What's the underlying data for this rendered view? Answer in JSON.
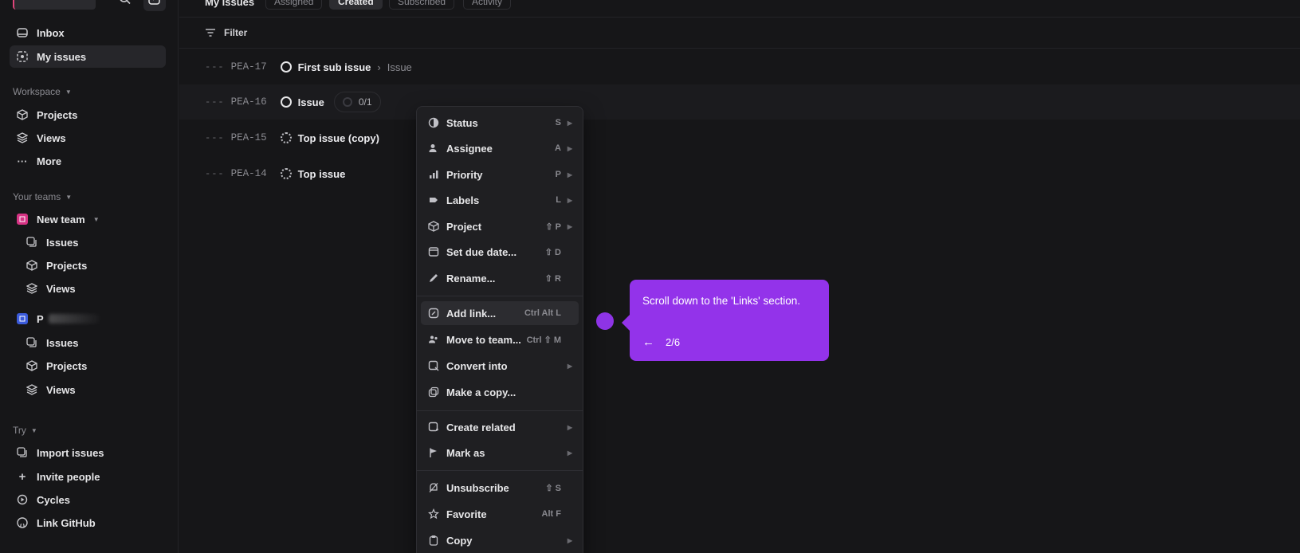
{
  "sidebar": {
    "primary": [
      {
        "label": "Inbox",
        "icon": "inbox-icon"
      },
      {
        "label": "My issues",
        "icon": "my-issues-icon"
      }
    ],
    "workspace": {
      "label": "Workspace",
      "items": [
        {
          "label": "Projects",
          "icon": "cube-icon"
        },
        {
          "label": "Views",
          "icon": "layers-icon"
        },
        {
          "label": "More",
          "icon": "ellipsis-icon"
        }
      ]
    },
    "teams": {
      "label": "Your teams",
      "team1": {
        "name": "New team",
        "items": [
          {
            "label": "Issues",
            "icon": "issues-icon"
          },
          {
            "label": "Projects",
            "icon": "cube-icon"
          },
          {
            "label": "Views",
            "icon": "layers-icon"
          }
        ]
      },
      "team2": {
        "name": "P",
        "items": [
          {
            "label": "Issues",
            "icon": "issues-icon"
          },
          {
            "label": "Projects",
            "icon": "cube-icon"
          },
          {
            "label": "Views",
            "icon": "layers-icon"
          }
        ]
      }
    },
    "try": {
      "label": "Try",
      "items": [
        {
          "label": "Import issues",
          "icon": "import-icon"
        },
        {
          "label": "Invite people",
          "icon": "plus-icon"
        },
        {
          "label": "Cycles",
          "icon": "cycle-icon"
        },
        {
          "label": "Link GitHub",
          "icon": "github-icon"
        }
      ]
    }
  },
  "header": {
    "title": "My issues",
    "tabs": [
      "Assigned",
      "Created",
      "Subscribed",
      "Activity"
    ],
    "active_tab": "Created"
  },
  "filter": {
    "label": "Filter"
  },
  "issues": [
    {
      "dash": "---",
      "id": "PEA-17",
      "title": "First sub issue",
      "parent": "Issue",
      "status": "todo"
    },
    {
      "dash": "---",
      "id": "PEA-16",
      "title": "Issue",
      "sub_progress": "0/1",
      "status": "todo"
    },
    {
      "dash": "---",
      "id": "PEA-15",
      "title": "Top issue (copy)",
      "status": "backlog"
    },
    {
      "dash": "---",
      "id": "PEA-14",
      "title": "Top issue",
      "status": "backlog"
    }
  ],
  "context_menu": {
    "items": [
      {
        "label": "Status",
        "shortcut": "S",
        "submenu": true,
        "icon": "status-icon"
      },
      {
        "label": "Assignee",
        "shortcut": "A",
        "submenu": true,
        "icon": "assignee-icon"
      },
      {
        "label": "Priority",
        "shortcut": "P",
        "submenu": true,
        "icon": "priority-icon"
      },
      {
        "label": "Labels",
        "shortcut": "L",
        "submenu": true,
        "icon": "label-icon"
      },
      {
        "label": "Project",
        "shortcut": "⇧ P",
        "submenu": true,
        "icon": "cube-icon"
      },
      {
        "label": "Set due date...",
        "shortcut": "⇧ D",
        "submenu": false,
        "icon": "calendar-icon"
      },
      {
        "label": "Rename...",
        "shortcut": "⇧ R",
        "submenu": false,
        "icon": "pencil-icon"
      },
      {
        "label": "Add link...",
        "shortcut": "Ctrl Alt L",
        "submenu": false,
        "icon": "link-icon"
      },
      {
        "label": "Move to team...",
        "shortcut": "Ctrl ⇧ M",
        "submenu": false,
        "icon": "team-icon"
      },
      {
        "label": "Convert into",
        "shortcut": "",
        "submenu": true,
        "icon": "convert-icon"
      },
      {
        "label": "Make a copy...",
        "shortcut": "",
        "submenu": false,
        "icon": "copy-icon"
      },
      {
        "label": "Create related",
        "shortcut": "",
        "submenu": true,
        "icon": "create-related-icon"
      },
      {
        "label": "Mark as",
        "shortcut": "",
        "submenu": true,
        "icon": "flag-icon"
      },
      {
        "label": "Unsubscribe",
        "shortcut": "⇧ S",
        "submenu": false,
        "icon": "bell-off-icon"
      },
      {
        "label": "Favorite",
        "shortcut": "Alt F",
        "submenu": false,
        "icon": "star-icon"
      },
      {
        "label": "Copy",
        "shortcut": "",
        "submenu": true,
        "icon": "clipboard-icon"
      }
    ],
    "highlighted": "Add link..."
  },
  "tooltip": {
    "message": "Scroll down to the 'Links' section.",
    "step": "2/6",
    "color": "#9333ea"
  },
  "colors": {
    "background": "#161618",
    "accent": "#9333ea",
    "team1_badge": "#d63384",
    "team2_badge": "#3b5bdb"
  }
}
